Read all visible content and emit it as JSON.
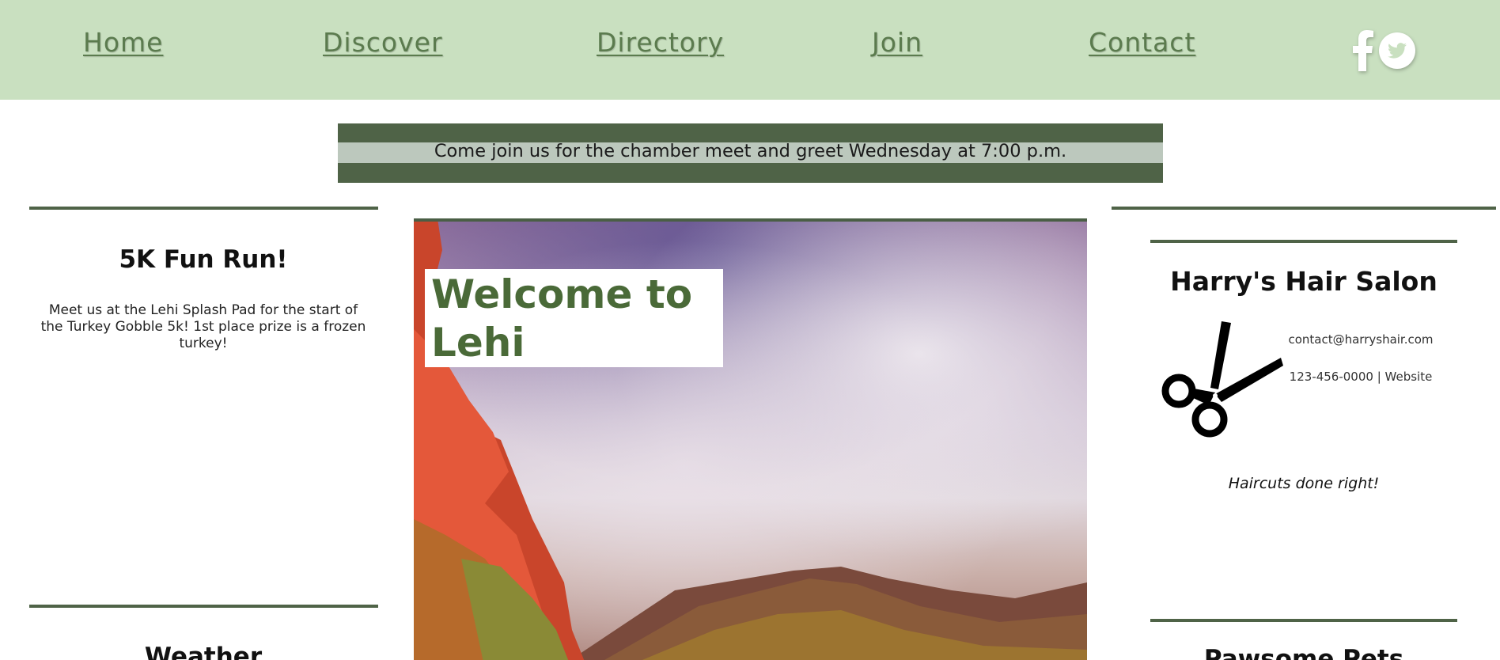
{
  "nav": {
    "items": [
      {
        "label": "Home"
      },
      {
        "label": "Discover"
      },
      {
        "label": "Directory"
      },
      {
        "label": "Join"
      },
      {
        "label": "Contact"
      }
    ],
    "social": [
      "facebook-icon",
      "twitter-icon"
    ]
  },
  "banner": {
    "text": "Come join us for the chamber meet and greet Wednesday at 7:00 p.m."
  },
  "left": {
    "event_title": "5K Fun Run!",
    "event_text": "Meet us at the Lehi Splash Pad for the start of the Turkey Gobble 5k! 1st place prize is a frozen turkey!",
    "weather_title": "Weather"
  },
  "hero": {
    "welcome": "Welcome to Lehi"
  },
  "right": {
    "business_name": "Harry's Hair Salon",
    "email": "contact@harryshair.com",
    "phone": "123-456-0000 | Website",
    "tagline": "Haircuts done right!",
    "next_title": "Pawsome Pets"
  },
  "colors": {
    "nav_bg": "#c9e0c0",
    "accent_dark": "#4f6347",
    "nav_link": "#5b7b4e",
    "welcome_text": "#4a6a38"
  }
}
